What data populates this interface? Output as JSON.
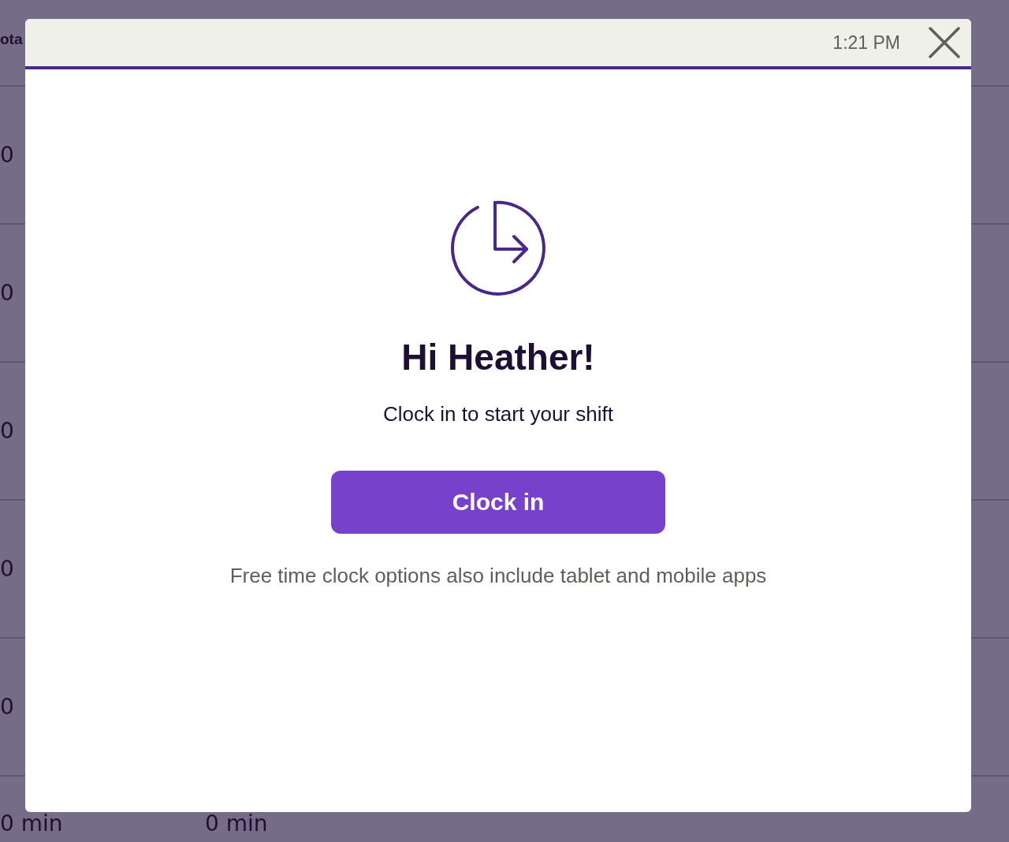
{
  "background_table": {
    "header": "ota",
    "rows": [
      {
        "cells": [
          "0"
        ]
      },
      {
        "cells": [
          "0"
        ]
      },
      {
        "cells": [
          "0"
        ]
      },
      {
        "cells": [
          "0"
        ]
      },
      {
        "cells": [
          "0"
        ]
      },
      {
        "cells": [
          "0 min",
          "0 min"
        ]
      }
    ]
  },
  "modal": {
    "time": "1:21 PM",
    "heading": "Hi Heather!",
    "message": "Clock in to start your shift",
    "button": "Clock in",
    "footnote": "Free time clock options also include tablet and mobile apps"
  }
}
